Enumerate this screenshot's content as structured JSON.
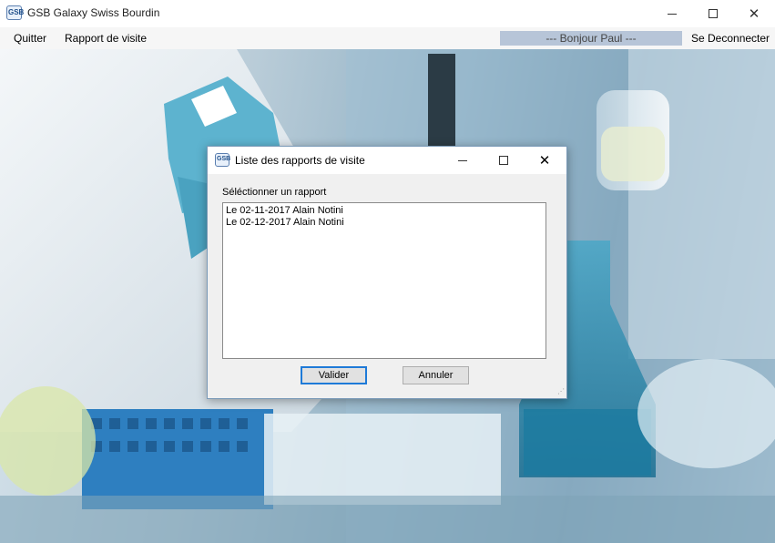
{
  "window": {
    "title": "GSB Galaxy Swiss Bourdin",
    "logo_text": "GSB",
    "controls": {
      "minimize": "minimize-icon",
      "maximize": "maximize-icon",
      "close": "close-icon"
    }
  },
  "menu": {
    "quit_label": "Quitter",
    "report_label": "Rapport de visite",
    "greeting": "--- Bonjour Paul ---",
    "logout_label": "Se Deconnecter"
  },
  "dialog": {
    "title": "Liste des rapports de visite",
    "logo_text": "GSB",
    "select_label": "Séléctionner un rapport",
    "reports": [
      "Le 02-11-2017 Alain Notini",
      "Le 02-12-2017 Alain Notini"
    ],
    "validate_label": "Valider",
    "cancel_label": "Annuler"
  },
  "colors": {
    "accent": "#1e7ad8",
    "greeting_bg": "#b7c5d8",
    "dialog_bg": "#f0f0f0"
  }
}
